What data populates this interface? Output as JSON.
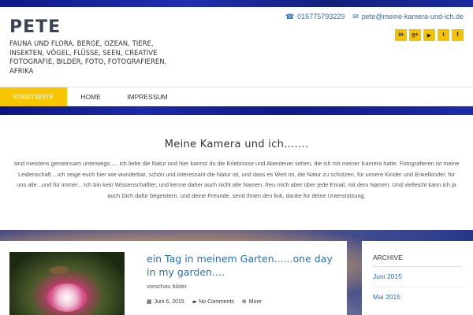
{
  "site": {
    "title": "PETE",
    "tagline": "FAUNA UND FLORA, BERGE, OZEAN, TIERE, INSEKTEN, VÖGEL, FLÜSSE, SEEN, CREATIVE FOTOGRAFIE, BILDER, FOTO, FOTOGRAFIEREN, AFRIKA"
  },
  "contact": {
    "phone": "015775793229",
    "email": "pete@meine-kamera-und-ich.de"
  },
  "socials": [
    {
      "icon": "linkedin-icon",
      "glyph": "in"
    },
    {
      "icon": "google-plus-icon",
      "glyph": "g+"
    },
    {
      "icon": "youtube-icon",
      "glyph": "▶"
    },
    {
      "icon": "twitter-icon",
      "glyph": "t"
    },
    {
      "icon": "facebook-icon",
      "glyph": "f"
    }
  ],
  "nav": {
    "items": [
      "STARTSEITE",
      "HOME",
      "IMPRESSUM"
    ]
  },
  "intro": {
    "heading": "Meine Kamera und ich.......",
    "text": "sind meistens gemeinsam unterwegs..... ich liebe die Natur und hier kannst du die Erlebnisse und Abenteuer sehen, die ich mit meiner Kamera hatte. Fotografieren ist meine Leidenschaft....ich zeige euch hier wie wunderbar, schön und interessant die Natur ist, und dass es Wert ist, die Natur zu schützen, für unsere Kinder und Enkelkinder, für uns alle...und für immer... Ich bin kein Wissenschaftler, und kenne daher auch nicht alle Namen, freu mich aber über jede Email, mit dem Namen. Und vielleicht kann ich ja auch Dich dafür begeistern, und deine Freunde, send ihnen den link, danke für deine Unterstützung."
  },
  "post": {
    "title": "ein Tag in meinem Garten......one day in my garden....",
    "excerpt": "vorschau bilder",
    "date": "Juni 6, 2015",
    "comments": "No Comments",
    "more": "More"
  },
  "sidebar": {
    "heading": "ARCHIVE",
    "archives": [
      "Juni 2015",
      "Mai 2015"
    ]
  },
  "colors": {
    "accent": "#f7c600",
    "link": "#2a6fb6",
    "stripe": "#1b2aa8"
  }
}
